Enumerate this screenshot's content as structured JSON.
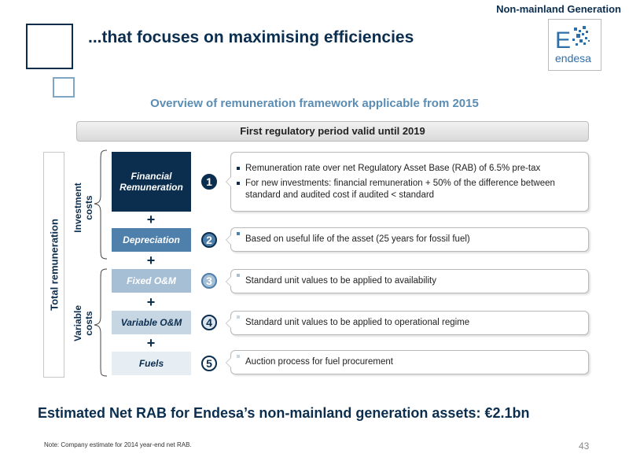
{
  "header": {
    "section_tag": "Non-mainland Generation",
    "title": "...that focuses on maximising efficiencies",
    "logo_letter": "E",
    "logo_text": "endesa"
  },
  "subtitle": "Overview of remuneration framework applicable from 2015",
  "period_banner": "First regulatory period valid until 2019",
  "side_labels": {
    "total": "Total remuneration",
    "investment_line1": "Investment",
    "investment_line2": "costs",
    "variable_line1": "Variable",
    "variable_line2": "costs"
  },
  "plus_sign": "+",
  "components": [
    {
      "label_line1": "Financial",
      "label_line2": "Remuneration",
      "number": "1",
      "bullets": [
        "Remuneration rate over net Regulatory Asset Base (RAB) of 6.5% pre-tax",
        "For new investments:  financial remuneration + 50% of the difference between standard and audited cost if audited < standard"
      ]
    },
    {
      "label_line1": "Depreciation",
      "number": "2",
      "bullets": [
        "Based on useful life of the asset (25 years for fossil fuel)"
      ]
    },
    {
      "label_line1": "Fixed O&M",
      "number": "3",
      "bullets": [
        "Standard unit values to be applied to availability"
      ]
    },
    {
      "label_line1": "Variable O&M",
      "number": "4",
      "bullets": [
        "Standard unit values to be applied to operational regime"
      ]
    },
    {
      "label_line1": "Fuels",
      "number": "5",
      "bullets": [
        "Auction process for fuel procurement"
      ]
    }
  ],
  "colors": {
    "dark_navy": "#0b2e4f",
    "mid_blue": "#4f7fab",
    "light_blue": "#a7bfd4",
    "pale_blue": "#c7d6e3",
    "paler_blue": "#e6edf3"
  },
  "summary": "Estimated Net RAB for Endesa’s non-mainland generation assets: €2.1bn",
  "footnote": "Note: Company estimate for 2014 year-end net RAB.",
  "page_number": "43"
}
